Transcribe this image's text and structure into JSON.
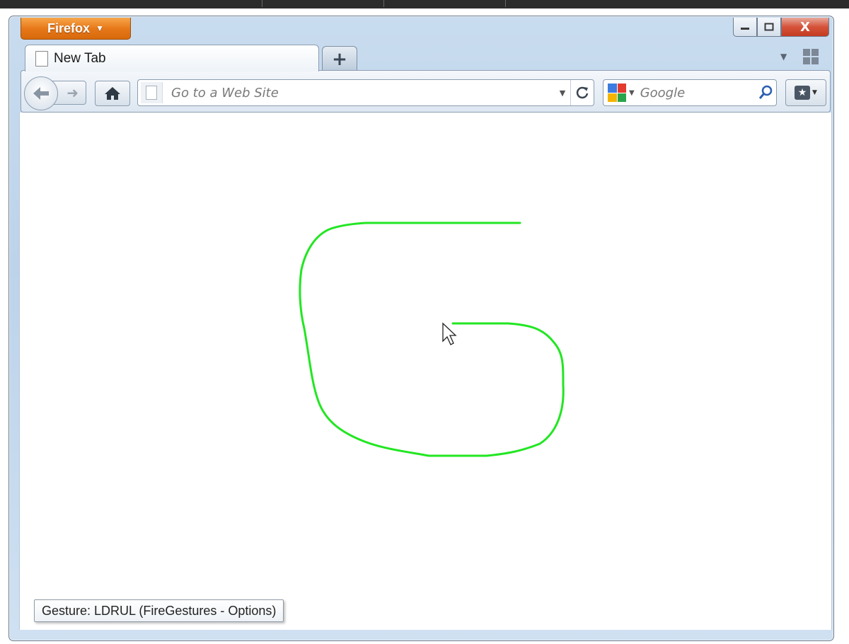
{
  "app": {
    "menu_button_label": "Firefox",
    "window_controls": {
      "minimize_icon": "minimize-icon",
      "maximize_icon": "maximize-icon",
      "close_label": "X"
    }
  },
  "tabs": [
    {
      "label": "New Tab",
      "icon": "page-icon",
      "active": true
    }
  ],
  "new_tab_label": "+",
  "navbar": {
    "back_icon": "back-arrow-icon",
    "forward_icon": "forward-arrow-icon",
    "home_icon": "home-icon",
    "url_placeholder": "Go to a Web Site",
    "url_value": "",
    "reload_icon": "reload-icon",
    "search_engine_icon": "google-icon",
    "search_placeholder": "Google",
    "search_value": "",
    "search_go_icon": "magnifier-icon",
    "bookmarks_icon": "bookmarks-star-icon"
  },
  "content": {
    "gesture_trail_color": "#22e622",
    "gesture_status": "Gesture: LDRUL (FireGestures - Options)"
  },
  "colors": {
    "firefox_button": "#e8791a",
    "close_button": "#d5533a",
    "frame": "#c9dcef"
  }
}
